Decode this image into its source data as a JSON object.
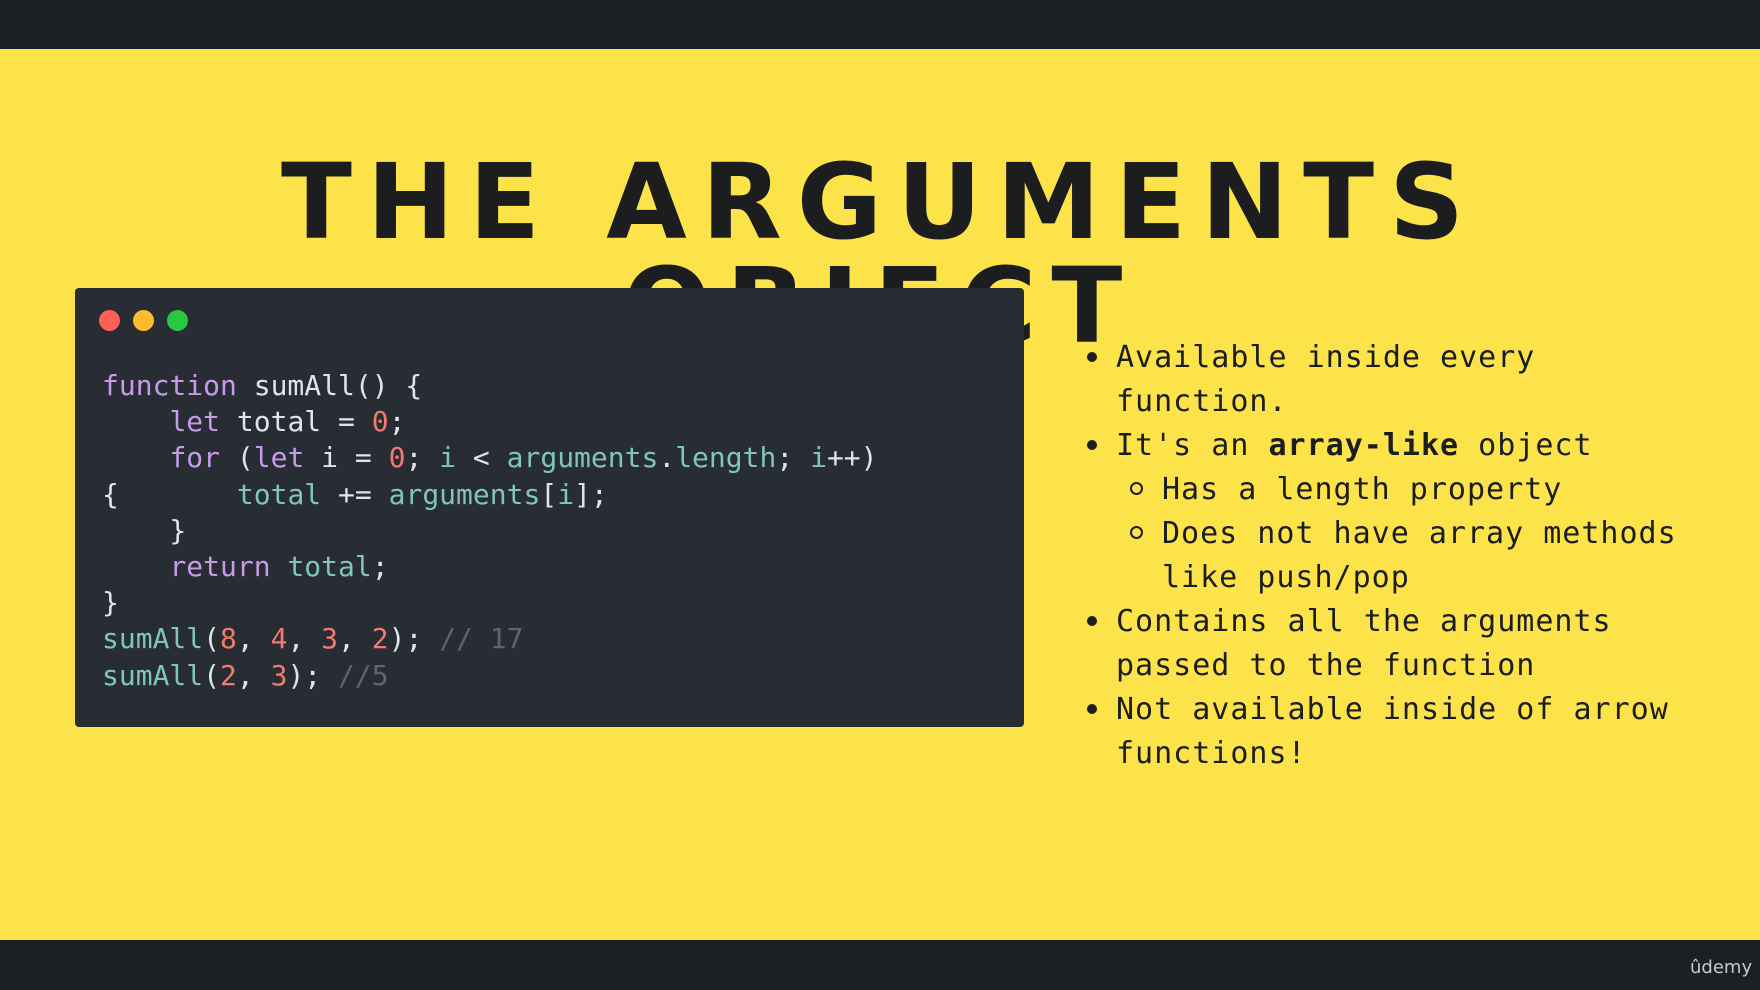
{
  "slide": {
    "title": "THE ARGUMENTS OBJECT"
  },
  "code": {
    "line1": {
      "kw": "function",
      "name": " sumAll() {"
    },
    "line2": {
      "indent": "    ",
      "kw": "let",
      "a": " total = ",
      "num": "0",
      "b": ";"
    },
    "line3": {
      "indent": "    ",
      "kw1": "for",
      "a": " (",
      "kw2": "let",
      "b": " i = ",
      "num": "0",
      "c": "; ",
      "v1": "i",
      "d": " < ",
      "v2": "arguments",
      "e": ".",
      "prop": "length",
      "f": "; ",
      "v3": "i",
      "g": "++)"
    },
    "line4": {
      "a": "{",
      "indent": "       ",
      "v1": "total",
      "b": " += ",
      "v2": "arguments",
      "c": "[",
      "v3": "i",
      "d": "];"
    },
    "line5": {
      "text": "    }"
    },
    "line6": {
      "indent": "    ",
      "kw": "return",
      "sp": " ",
      "v": "total",
      "b": ";"
    },
    "line7": {
      "text": "}"
    },
    "line8": {
      "fn": "sumAll",
      "a": "(",
      "n1": "8",
      "c1": ", ",
      "n2": "4",
      "c2": ", ",
      "n3": "3",
      "c3": ", ",
      "n4": "2",
      "b": "); ",
      "comment": "// 17"
    },
    "line9": {
      "fn": "sumAll",
      "a": "(",
      "n1": "2",
      "c1": ", ",
      "n2": "3",
      "b": "); ",
      "comment": "//5"
    }
  },
  "bullets": {
    "b1": "Available inside every function.",
    "b2_pre": "It's an ",
    "b2_bold": "array-like",
    "b2_post": " object",
    "b2_sub1": "Has a length property",
    "b2_sub2": "Does not have array methods like push/pop",
    "b3": "Contains all the arguments passed to the function",
    "b4": "Not available inside of arrow functions!"
  },
  "brand": {
    "logo_text": "ûdemy"
  },
  "colors": {
    "slide_background": "#fde34a",
    "code_background": "#282c33",
    "keyword": "#c89aea",
    "number": "#f07a6c",
    "variable": "#7fc4c0",
    "comment": "#5b6470"
  }
}
